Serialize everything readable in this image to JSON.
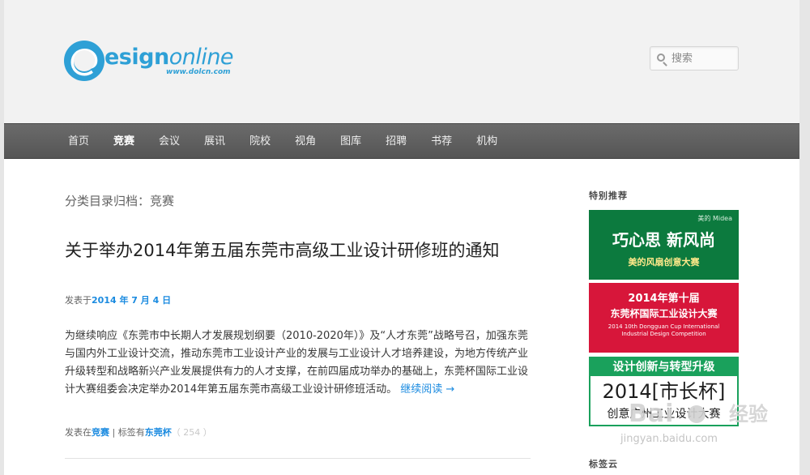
{
  "header": {
    "logo": {
      "mark": "@",
      "text_a": "esign",
      "text_b": "online",
      "url": "www.dolcn.com"
    },
    "search": {
      "placeholder": "搜索"
    }
  },
  "nav": {
    "items": [
      {
        "label": "首页"
      },
      {
        "label": "竞赛",
        "active": true
      },
      {
        "label": "会议"
      },
      {
        "label": "展讯"
      },
      {
        "label": "院校"
      },
      {
        "label": "视角"
      },
      {
        "label": "图库"
      },
      {
        "label": "招聘"
      },
      {
        "label": "书荐"
      },
      {
        "label": "机构"
      }
    ]
  },
  "main": {
    "archive_title": "分类目录归档：竞赛",
    "post": {
      "title": "关于举办2014年第五届东莞市高级工业设计研修班的通知",
      "date_prefix": "发表于",
      "date": "2014 年 7 月 4 日",
      "excerpt": "为继续响应《东莞市中长期人才发展规划纲要（2010-2020年）》及“人才东莞”战略号召，加强东莞与国内外工业设计交流，推动东莞市工业设计产业的发展与工业设计人才培养建设，为地方传统产业升级转型和战略新兴产业发展提供有力的人才支撑，在前四届成功举办的基础上，东莞杯国际工业设计大赛组委会决定举办2014年第五届东莞市高级工业设计研修班活动。",
      "read_more": "继续阅读 →",
      "meta": {
        "cat_prefix": "发表在",
        "category": "竞赛",
        "sep": " | ",
        "tag_prefix": "标签有",
        "tag": "东莞杯",
        "comment_count": "（ 254 ）"
      }
    }
  },
  "sidebar": {
    "widget_title_1": "特别推荐",
    "banners": [
      {
        "brand": "美的 Midea",
        "title": "巧心思 新风尚",
        "subtitle": "美的风扇创意大赛"
      },
      {
        "line1": "2014年第十届",
        "line2": "东莞杯国际工业设计大赛",
        "line3": "2014 10th Dongguan Cup International",
        "line4": "Industrial Design Competition"
      },
      {
        "top": "设计创新与转型升级",
        "mid": "2014[市长杯]",
        "bottom": "创意广州工业设计大赛"
      }
    ],
    "widget_title_2": "标签云"
  },
  "watermark": {
    "logo": "Bai",
    "brand": "经验",
    "url": "jingyan.baidu.com"
  },
  "colors": {
    "accent": "#1b8be0",
    "nav_bg": "#5e5e5e",
    "header_bg": "#f2f2f2"
  }
}
